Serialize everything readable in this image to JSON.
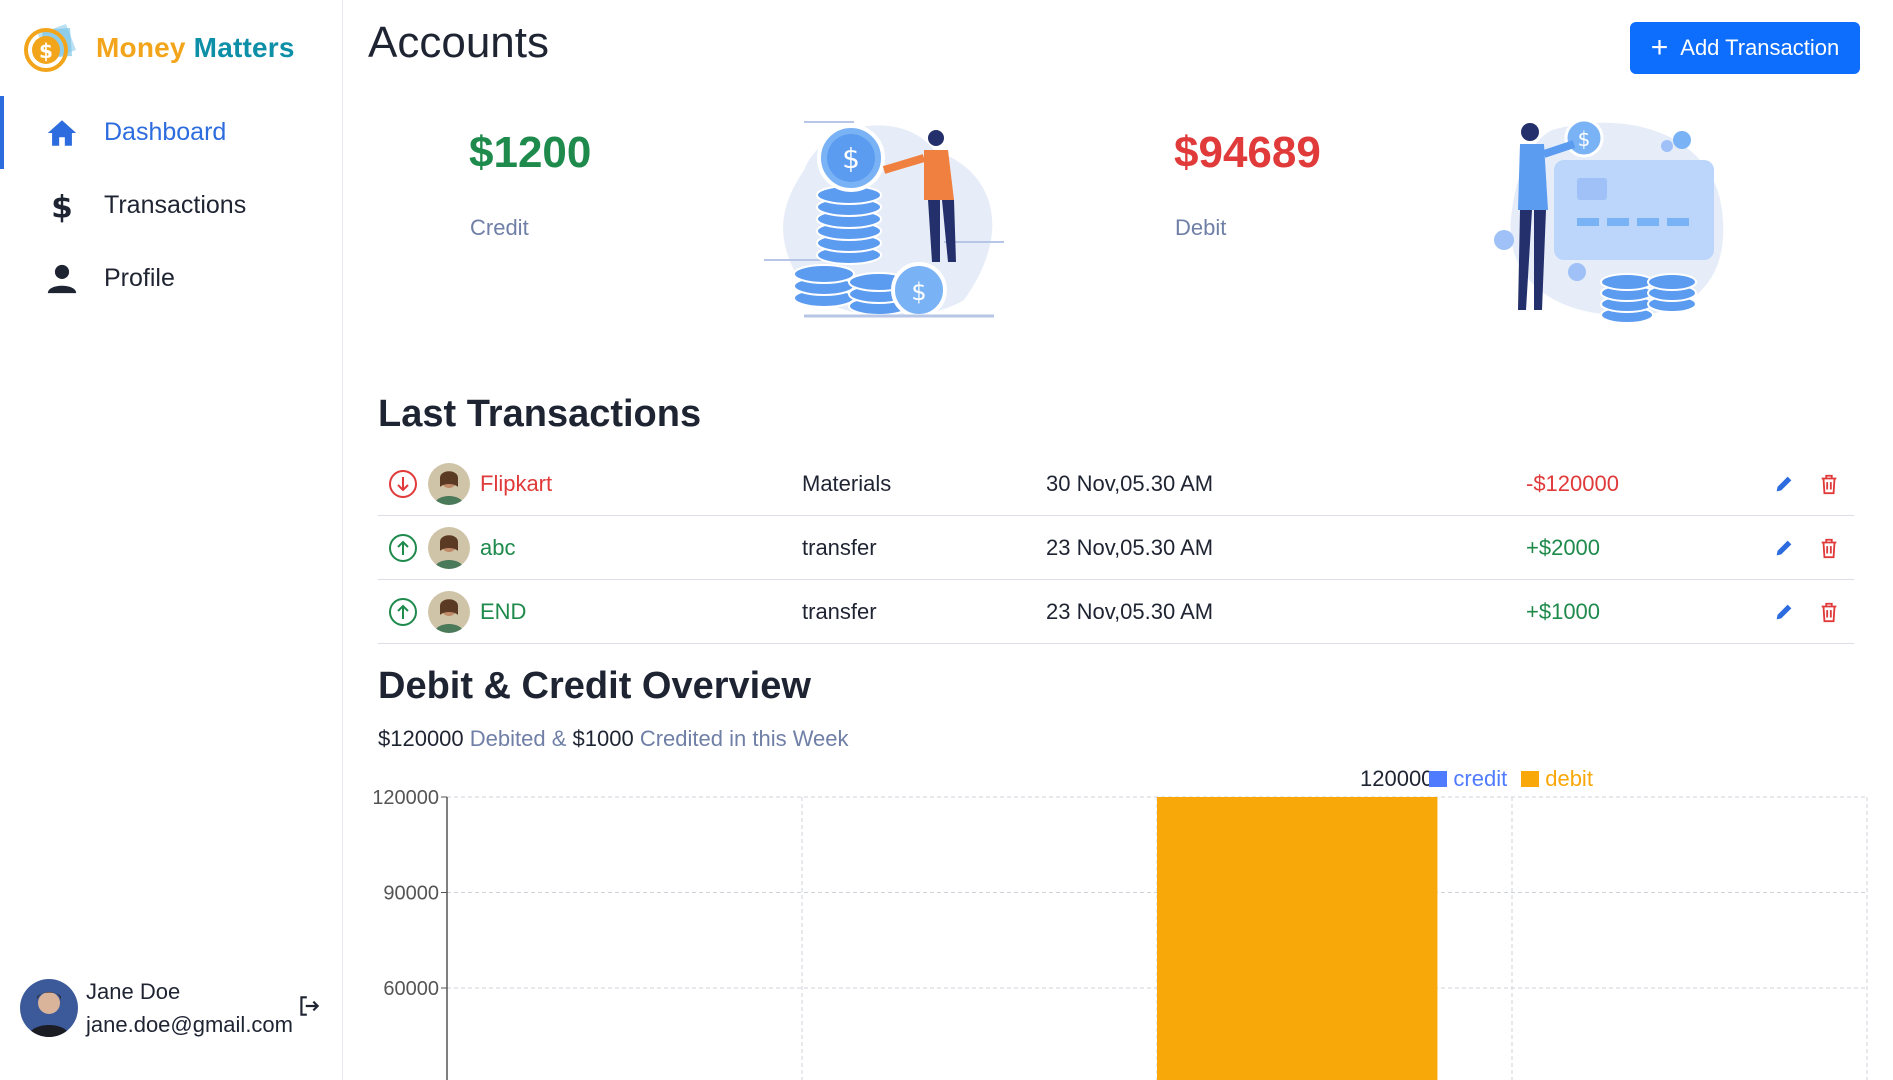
{
  "app": {
    "brand_word1": "Money",
    "brand_word2": "Matters"
  },
  "sidebar": {
    "items": [
      {
        "label": "Dashboard",
        "icon": "home-icon",
        "active": true
      },
      {
        "label": "Transactions",
        "icon": "dollar-icon",
        "active": false
      },
      {
        "label": "Profile",
        "icon": "user-icon",
        "active": false
      }
    ],
    "user": {
      "name": "Jane Doe",
      "email": "jane.doe@gmail.com"
    }
  },
  "header": {
    "title": "Accounts",
    "add_button": "Add Transaction"
  },
  "cards": {
    "credit": {
      "amount": "$1200",
      "label": "Credit"
    },
    "debit": {
      "amount": "$94689",
      "label": "Debit"
    }
  },
  "transactions": {
    "title": "Last Transactions",
    "rows": [
      {
        "direction": "down",
        "name": "Flipkart",
        "category": "Materials",
        "date": "30 Nov,05.30 AM",
        "amount": "-$120000",
        "type": "debit"
      },
      {
        "direction": "up",
        "name": "abc",
        "category": "transfer",
        "date": "23 Nov,05.30 AM",
        "amount": "+$2000",
        "type": "credit"
      },
      {
        "direction": "up",
        "name": "END",
        "category": "transfer",
        "date": "23 Nov,05.30 AM",
        "amount": "+$1000",
        "type": "credit"
      }
    ]
  },
  "overview": {
    "title": "Debit & Credit Overview",
    "debited_amount": "$120000",
    "debited_text": "Debited &",
    "credited_amount": "$1000",
    "credited_text": "Credited in this Week"
  },
  "colors": {
    "accent": "#0d6efd",
    "credit": "#1e8a4c",
    "debit_text": "#e03a3a",
    "bar_debit": "#f9a80a",
    "bar_credit": "#4f7cff"
  },
  "chart_data": {
    "type": "bar",
    "categories": [
      "",
      "",
      "",
      ""
    ],
    "series": [
      {
        "name": "credit",
        "values": [
          0,
          0,
          0,
          0
        ]
      },
      {
        "name": "debit",
        "values": [
          0,
          0,
          120000,
          0
        ]
      }
    ],
    "y_ticks": [
      "120000",
      "90000",
      "60000"
    ],
    "ylim": [
      60000,
      120000
    ],
    "data_labels": [
      "120000"
    ],
    "legend": [
      "credit",
      "debit"
    ],
    "legend_position": "top-right",
    "grid": true
  }
}
